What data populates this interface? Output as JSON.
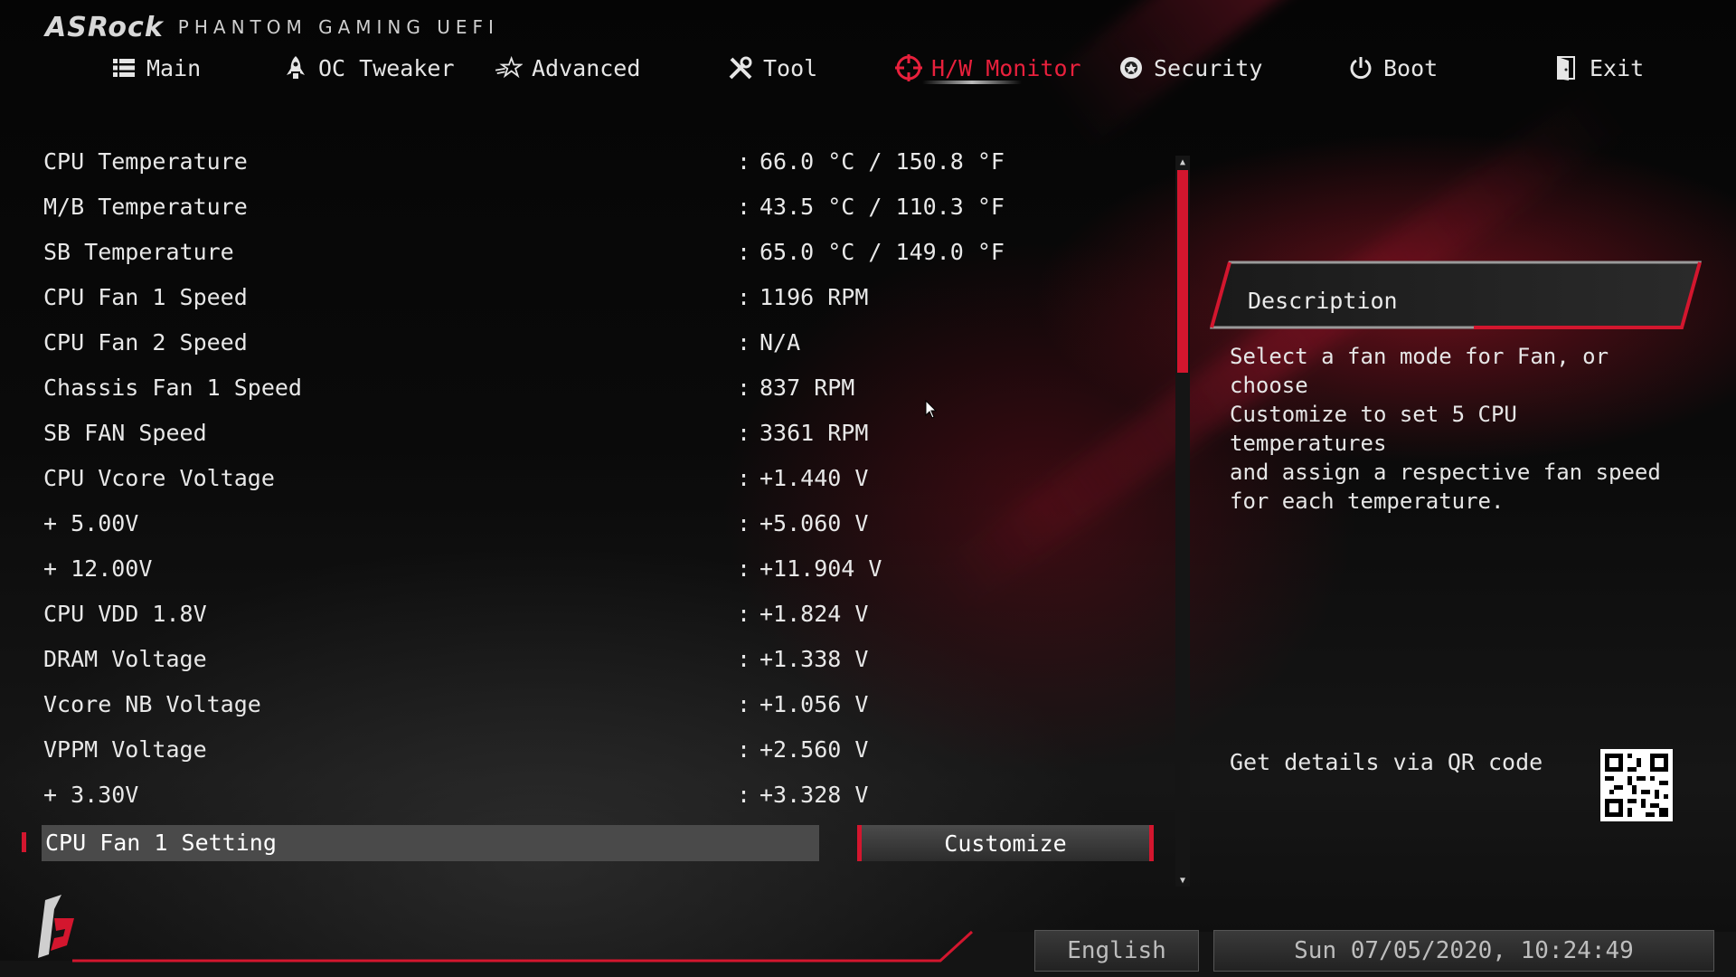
{
  "header": {
    "brand": "ASRock",
    "subtitle": "PHANTOM GAMING UEFI"
  },
  "nav": [
    {
      "label": "Main",
      "icon": "list-icon",
      "active": false
    },
    {
      "label": "OC Tweaker",
      "icon": "rocket-icon",
      "active": false
    },
    {
      "label": "Advanced",
      "icon": "star-icon",
      "active": false
    },
    {
      "label": "Tool",
      "icon": "tools-icon",
      "active": false
    },
    {
      "label": "H/W Monitor",
      "icon": "crosshair-icon",
      "active": true
    },
    {
      "label": "Security",
      "icon": "shield-icon",
      "active": false
    },
    {
      "label": "Boot",
      "icon": "power-icon",
      "active": false
    },
    {
      "label": "Exit",
      "icon": "exit-door-icon",
      "active": false
    }
  ],
  "monitor": [
    {
      "label": "CPU Temperature",
      "value": "66.0 °C / 150.8 °F"
    },
    {
      "label": "M/B Temperature",
      "value": "43.5 °C / 110.3 °F"
    },
    {
      "label": "SB Temperature",
      "value": "65.0 °C / 149.0 °F"
    },
    {
      "label": "CPU Fan 1 Speed",
      "value": "1196 RPM"
    },
    {
      "label": "CPU Fan 2 Speed",
      "value": "N/A"
    },
    {
      "label": "Chassis Fan 1 Speed",
      "value": "837 RPM"
    },
    {
      "label": "SB FAN Speed",
      "value": "3361 RPM"
    },
    {
      "label": "CPU Vcore Voltage",
      "value": "+1.440 V"
    },
    {
      "label": "+ 5.00V",
      "value": "+5.060 V"
    },
    {
      "label": "+ 12.00V",
      "value": "+11.904 V"
    },
    {
      "label": "CPU VDD 1.8V",
      "value": "+1.824 V"
    },
    {
      "label": "DRAM Voltage",
      "value": "+1.338 V"
    },
    {
      "label": "Vcore NB Voltage",
      "value": "+1.056 V"
    },
    {
      "label": "VPPM Voltage",
      "value": "+2.560 V"
    },
    {
      "label": "+ 3.30V",
      "value": "+3.328 V"
    }
  ],
  "separator": ":",
  "selected_setting": {
    "label": "CPU Fan 1 Setting",
    "value": "Customize"
  },
  "description": {
    "title": "Description",
    "text": "Select a fan mode for Fan, or choose\nCustomize to set 5 CPU temperatures\nand assign a respective fan speed\nfor each temperature."
  },
  "qr": {
    "label": "Get details via QR code"
  },
  "footer": {
    "language": "English",
    "datetime": "Sun 07/05/2020, 10:24:49"
  },
  "colors": {
    "accent": "#d3162e",
    "active_nav": "#e8203c",
    "text": "#e8e8e8",
    "selected_row": "#4a4a4a"
  }
}
